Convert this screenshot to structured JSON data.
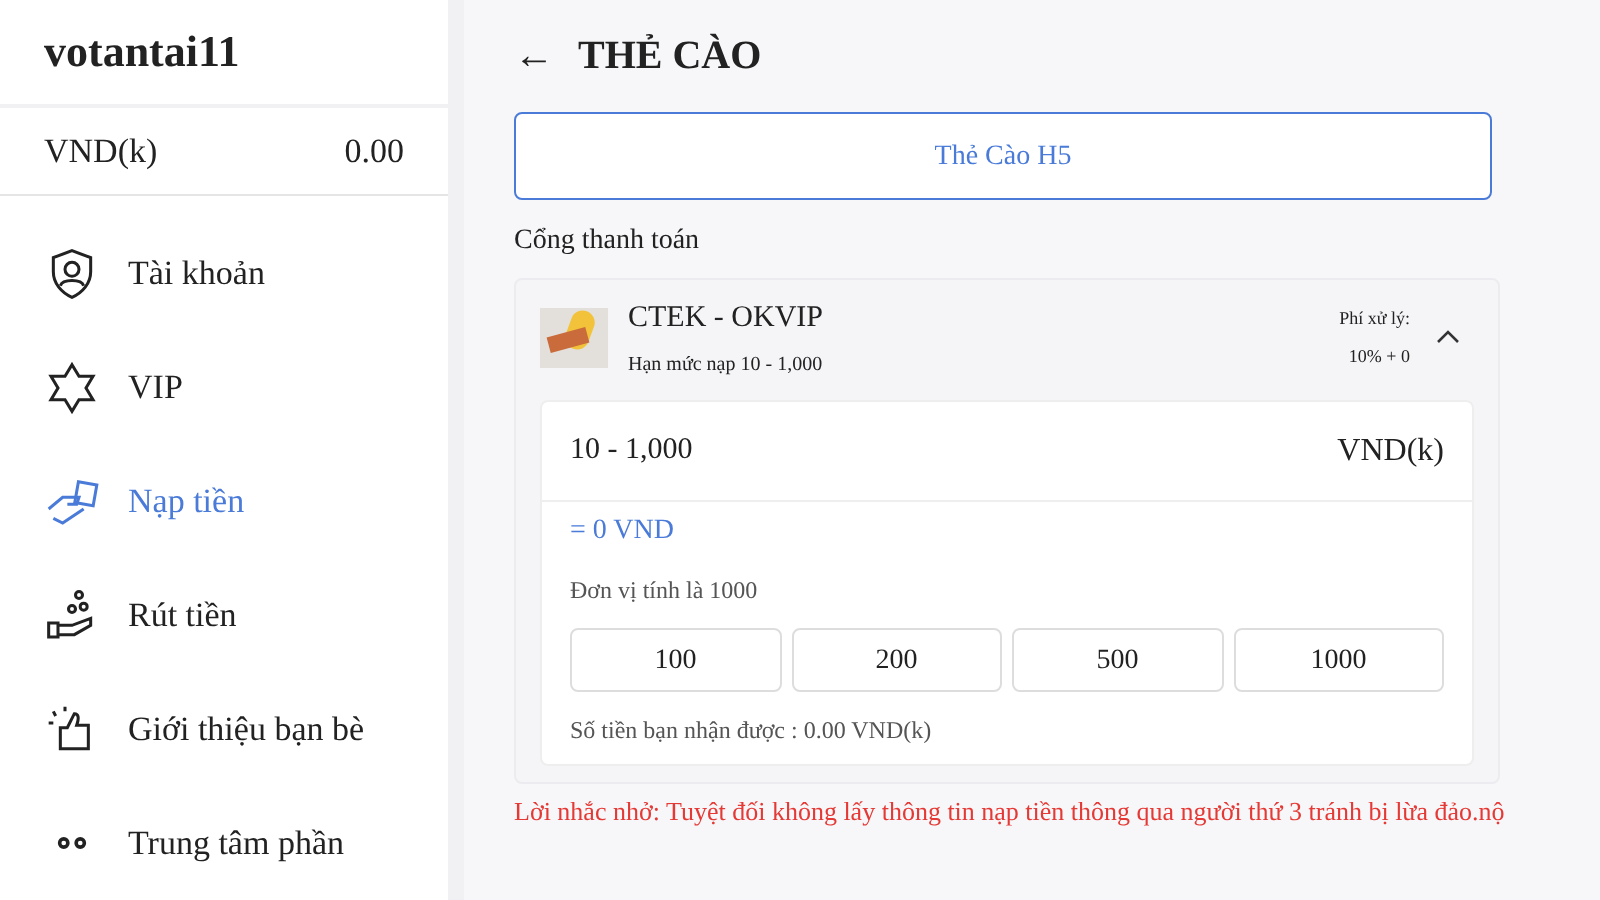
{
  "sidebar": {
    "username": "votantai11",
    "balance": {
      "currency": "VND(k)",
      "amount": "0.00"
    },
    "items": [
      {
        "label": "Tài khoản",
        "selected": false
      },
      {
        "label": "VIP",
        "selected": false
      },
      {
        "label": "Nạp tiền",
        "selected": true
      },
      {
        "label": "Rút tiền",
        "selected": false
      },
      {
        "label": "Giới thiệu bạn bè",
        "selected": false
      },
      {
        "label": "Trung tâm phần",
        "selected": false
      }
    ]
  },
  "header": {
    "back": "←",
    "title": "THẺ CÀO"
  },
  "tabs": [
    {
      "label": "Thẻ Cào H5",
      "selected": true
    }
  ],
  "gateway_label": "Cổng thanh toán",
  "gateway": {
    "name": "CTEK - OKVIP",
    "limit": "Hạn mức nạp 10 - 1,000",
    "fee_label": "Phí xử lý:",
    "fee": "10% + 0",
    "expanded": true,
    "amount": {
      "placeholder": "10 - 1,000",
      "unit": "VND(k)"
    },
    "converted": "= 0 VND",
    "unit_note": "Đơn vị tính là 1000",
    "presets": [
      {
        "label": "100"
      },
      {
        "label": "200"
      },
      {
        "label": "500"
      },
      {
        "label": "1000"
      }
    ],
    "receive": "Số tiền bạn nhận được : 0.00 VND(k)"
  },
  "warning": "Lời nhắc nhở: Tuyệt đối không lấy thông tin nạp tiền thông qua người thứ 3 tránh bị lừa đảo.nộ"
}
